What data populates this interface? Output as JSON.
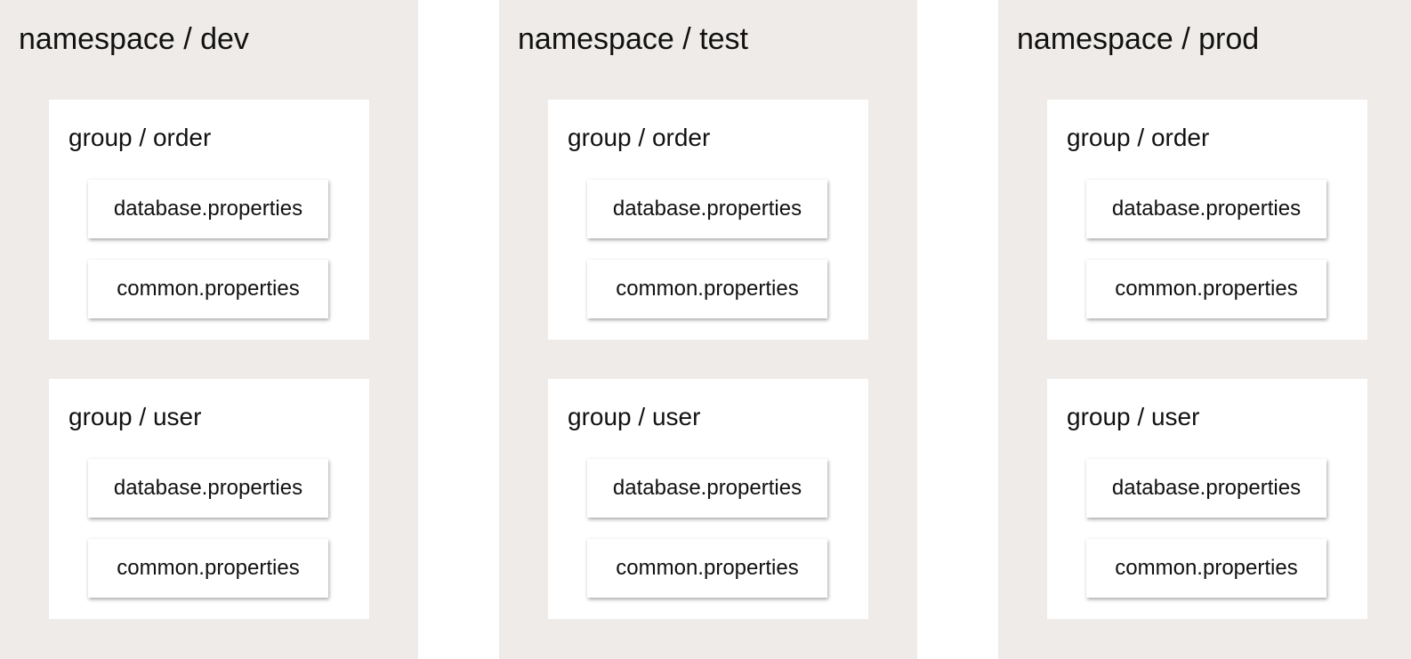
{
  "namespaces": [
    {
      "title": "namespace / dev",
      "groups": [
        {
          "title": "group / order",
          "files": [
            "database.properties",
            "common.properties"
          ]
        },
        {
          "title": "group / user",
          "files": [
            "database.properties",
            "common.properties"
          ]
        }
      ]
    },
    {
      "title": "namespace / test",
      "groups": [
        {
          "title": "group / order",
          "files": [
            "database.properties",
            "common.properties"
          ]
        },
        {
          "title": "group / user",
          "files": [
            "database.properties",
            "common.properties"
          ]
        }
      ]
    },
    {
      "title": "namespace / prod",
      "groups": [
        {
          "title": "group / order",
          "files": [
            "database.properties",
            "common.properties"
          ]
        },
        {
          "title": "group / user",
          "files": [
            "database.properties",
            "common.properties"
          ]
        }
      ]
    }
  ],
  "colors": {
    "namespace_background": "#eeebe8",
    "group_background": "#ffffff",
    "text": "#111111"
  }
}
